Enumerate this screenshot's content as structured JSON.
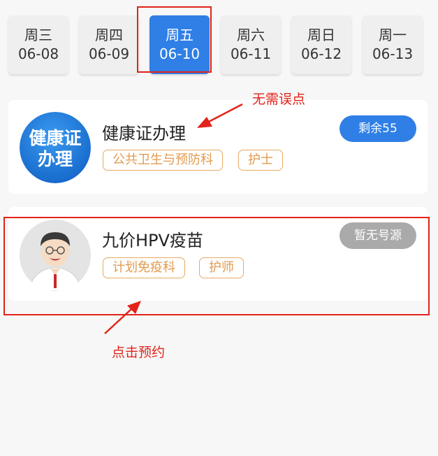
{
  "date_tabs": [
    {
      "weekday": "周三",
      "date": "06-08"
    },
    {
      "weekday": "周四",
      "date": "06-09"
    },
    {
      "weekday": "周五",
      "date": "06-10"
    },
    {
      "weekday": "周六",
      "date": "06-11"
    },
    {
      "weekday": "周日",
      "date": "06-12"
    },
    {
      "weekday": "周一",
      "date": "06-13"
    }
  ],
  "services": [
    {
      "logo_text": "健康证办理",
      "title": "健康证办理",
      "tags": [
        "公共卫生与预防科",
        "护士"
      ],
      "badge": "剩余55",
      "badge_color": "#2f7fe6"
    },
    {
      "title": "九价HPV疫苗",
      "tags": [
        "计划免疫科",
        "护师"
      ],
      "badge": "暂无号源",
      "badge_color": "#aaaaaa"
    }
  ],
  "annotations": {
    "no_click_note": "无需误点",
    "click_note": "点击预约"
  },
  "colors": {
    "accent": "#2f7fe6",
    "annotation": "#e2231a",
    "tag_border": "#e8a964",
    "tag_text": "#e29b4f"
  }
}
